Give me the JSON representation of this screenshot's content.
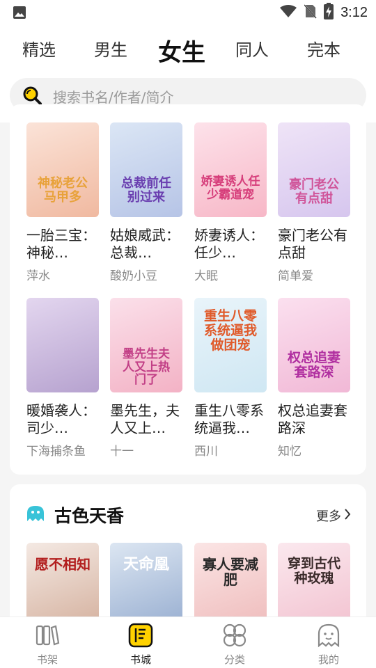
{
  "status_bar": {
    "time": "3:12"
  },
  "tabs": [
    "精选",
    "男生",
    "女生",
    "同人",
    "完本"
  ],
  "search": {
    "placeholder": "搜索书名/作者/简介"
  },
  "grid_books": [
    {
      "title": "一胎三宝：神秘…",
      "author": "萍水",
      "cover_text": "神秘老公马甲多",
      "c1": "#fbe3d8",
      "c2": "#f0b9a0",
      "tc": "#e8a23a"
    },
    {
      "title": "姑娘威武：总裁…",
      "author": "酸奶小豆",
      "cover_text": "总裁前任别过来",
      "c1": "#dbe6f5",
      "c2": "#b6c4e6",
      "tc": "#6a3fb0"
    },
    {
      "title": "娇妻诱人：任少…",
      "author": "大眠",
      "cover_text": "娇妻诱人任少霸道宠",
      "c1": "#fde2ea",
      "c2": "#f7b7c7",
      "tc": "#d63d7a"
    },
    {
      "title": "豪门老公有点甜",
      "author": "简单爱",
      "cover_text": "豪门老公有点甜",
      "c1": "#efe4f7",
      "c2": "#d6c6ee",
      "tc": "#d0559a"
    },
    {
      "title": "暖婚袭人：司少…",
      "author": "下海捕条鱼",
      "cover_text": "",
      "c1": "#e3d6ef",
      "c2": "#b6a2cf",
      "tc": "#6b4fa0"
    },
    {
      "title": "墨先生，夫人又上…",
      "author": "十一",
      "cover_text": "墨先生夫人又上热门了",
      "c1": "#fbe0ea",
      "c2": "#f3b2c5",
      "tc": "#c23f86"
    },
    {
      "title": "重生八零系统逼我…",
      "author": "西川",
      "cover_text": "重生八零系统逼我做团宠",
      "c1": "#e9f4fa",
      "c2": "#cfe7f3",
      "tc": "#e05a2a"
    },
    {
      "title": "权总追妻套路深",
      "author": "知忆",
      "cover_text": "权总追妻套路深",
      "c1": "#fbe0ef",
      "c2": "#f1b8d6",
      "tc": "#b02fa0"
    }
  ],
  "section": {
    "title": "古色天香",
    "more": "更多",
    "books": [
      {
        "cover_text": "愿不相知",
        "c1": "#f4e9e3",
        "c2": "#d8b7a6",
        "tc": "#b21e1e"
      },
      {
        "cover_text": "天命凰",
        "c1": "#dce6f2",
        "c2": "#9fb4d4",
        "tc": "#ffffff"
      },
      {
        "cover_text": "寡人要减肥",
        "c1": "#fbe5e5",
        "c2": "#f0c0c0",
        "tc": "#2a2a2a"
      },
      {
        "cover_text": "穿到古代种玫瑰",
        "c1": "#fbe8ee",
        "c2": "#f3c6d3",
        "tc": "#3a2a2a"
      }
    ]
  },
  "bottom_nav": [
    {
      "label": "书架",
      "icon": "bookshelf-icon"
    },
    {
      "label": "书城",
      "icon": "bookstore-icon"
    },
    {
      "label": "分类",
      "icon": "category-icon"
    },
    {
      "label": "我的",
      "icon": "profile-icon"
    }
  ],
  "colors": {
    "accent": "#ffd200",
    "tab_active_text": "#111111",
    "section_icon": "#38c3d8"
  }
}
